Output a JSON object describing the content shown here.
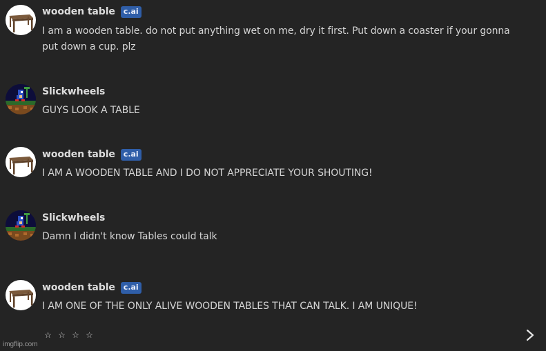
{
  "messages": [
    {
      "author": "wooden table",
      "badge": "c.ai",
      "avatar_icon": "wooden-table-avatar",
      "text": "I am a wooden table. do not put anything wet on me, dry it first. Put down a coaster if your gonna put down a cup. plz"
    },
    {
      "author": "Slickwheels",
      "avatar_icon": "pixel-art-sonic-avatar",
      "text": "GUYS LOOK A TABLE"
    },
    {
      "author": "wooden table",
      "badge": "c.ai",
      "avatar_icon": "wooden-table-avatar",
      "text": "I AM A WOODEN TABLE AND I DO NOT APPRECIATE YOUR SHOUTING!"
    },
    {
      "author": "Slickwheels",
      "avatar_icon": "pixel-art-sonic-avatar",
      "text": "Damn I didn't know Tables could talk"
    },
    {
      "author": "wooden table",
      "badge": "c.ai",
      "avatar_icon": "wooden-table-avatar",
      "text": "I AM ONE OF THE ONLY ALIVE WOODEN TABLES THAT CAN TALK. I AM UNIQUE!"
    }
  ],
  "rating": {
    "stars": [
      "☆",
      "☆",
      "☆",
      "☆"
    ],
    "filled": 0,
    "max": 4
  },
  "controls": {
    "next_icon": "chevron-right-icon"
  },
  "watermark": "imgflip.com",
  "colors": {
    "background": "#242424",
    "badge": "#2f5ea8",
    "text": "#d4d4d4"
  }
}
